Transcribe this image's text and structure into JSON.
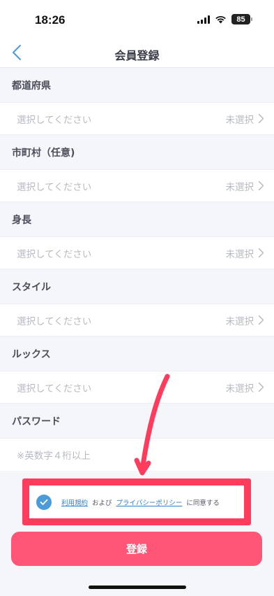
{
  "status_bar": {
    "time": "18:26",
    "battery": "85"
  },
  "nav": {
    "title": "会員登録"
  },
  "form": {
    "sections": [
      {
        "label": "都道府県",
        "placeholder": "選択してください",
        "status": "未選択"
      },
      {
        "label": "市町村（任意)",
        "placeholder": "選択してください",
        "status": "未選択"
      },
      {
        "label": "身長",
        "placeholder": "選択してください",
        "status": "未選択"
      },
      {
        "label": "スタイル",
        "placeholder": "選択してください",
        "status": "未選択"
      },
      {
        "label": "ルックス",
        "placeholder": "選択してください",
        "status": "未選択"
      }
    ],
    "password": {
      "label": "パスワード",
      "placeholder": "※英数字４桁以上",
      "value": ""
    }
  },
  "agreement": {
    "checked": true,
    "terms_link": "利用規約",
    "and": "および",
    "privacy_link": "プライバシーポリシー",
    "suffix": "に同意する"
  },
  "register_button": {
    "label": "登録"
  },
  "colors": {
    "accent": "#ff5577",
    "annotation": "#ff3c5e",
    "check": "#4c9bd9",
    "link": "#2f7fcf"
  }
}
